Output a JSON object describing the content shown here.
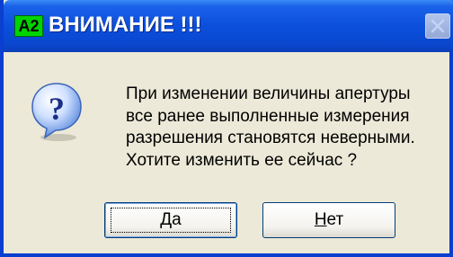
{
  "window": {
    "app_badge": "A2",
    "title": "ВНИМАНИЕ !!!",
    "close_icon": "close-x-icon"
  },
  "dialog": {
    "icon": "question-icon",
    "message_lines": [
      "При изменении величины апертуры",
      "все ранее выполненные измерения",
      "разрешения становятся неверными.",
      "Хотите изменить ее сейчас ?"
    ]
  },
  "buttons": {
    "yes": {
      "mnemonic": "Д",
      "rest": "а"
    },
    "no": {
      "mnemonic": "Н",
      "rest": "ет"
    }
  },
  "colors": {
    "titlebar": "#0b4fdc",
    "badge": "#00d400",
    "dialog_bg": "#ece9d8"
  }
}
